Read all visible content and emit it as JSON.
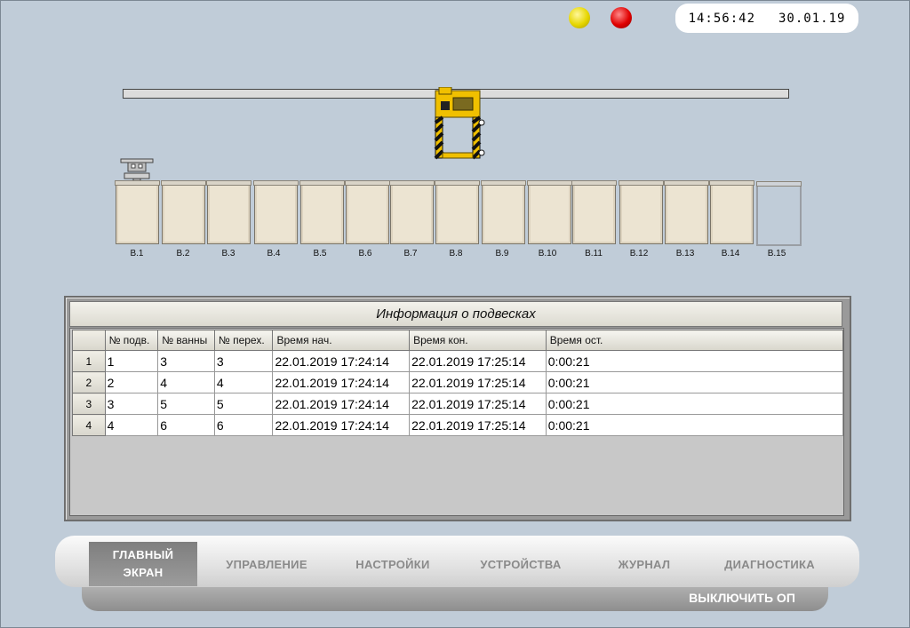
{
  "header": {
    "clock_time": "14:56:42",
    "clock_date": "30.01.19",
    "indicators": [
      {
        "name": "yellow-lamp",
        "color": "#e6d600"
      },
      {
        "name": "red-lamp",
        "color": "#e00000"
      }
    ]
  },
  "line": {
    "baths": [
      {
        "label": "B.1",
        "state": "full"
      },
      {
        "label": "B.2",
        "state": "full"
      },
      {
        "label": "B.3",
        "state": "full"
      },
      {
        "label": "B.4",
        "state": "full"
      },
      {
        "label": "B.5",
        "state": "full"
      },
      {
        "label": "B.6",
        "state": "full"
      },
      {
        "label": "B.7",
        "state": "full"
      },
      {
        "label": "B.8",
        "state": "full"
      },
      {
        "label": "B.9",
        "state": "full"
      },
      {
        "label": "B.10",
        "state": "full"
      },
      {
        "label": "B.11",
        "state": "full"
      },
      {
        "label": "B.12",
        "state": "full"
      },
      {
        "label": "B.13",
        "state": "full"
      },
      {
        "label": "B.14",
        "state": "full"
      },
      {
        "label": "B.15",
        "state": "empty"
      }
    ],
    "crane_color": "#f0c000"
  },
  "info_panel": {
    "title": "Информация о подвесках",
    "columns": [
      "",
      "№ подв.",
      "№ ванны",
      "№ перех.",
      "Время нач.",
      "Время кон.",
      "Время ост."
    ],
    "rows": [
      {
        "num": "1",
        "cells": [
          "1",
          "3",
          "3",
          "22.01.2019 17:24:14",
          "22.01.2019 17:25:14",
          "0:00:21"
        ]
      },
      {
        "num": "2",
        "cells": [
          "2",
          "4",
          "4",
          "22.01.2019 17:24:14",
          "22.01.2019 17:25:14",
          "0:00:21"
        ]
      },
      {
        "num": "3",
        "cells": [
          "3",
          "5",
          "5",
          "22.01.2019 17:24:14",
          "22.01.2019 17:25:14",
          "0:00:21"
        ]
      },
      {
        "num": "4",
        "cells": [
          "4",
          "6",
          "6",
          "22.01.2019 17:24:14",
          "22.01.2019 17:25:14",
          "0:00:21"
        ]
      }
    ]
  },
  "menu": {
    "items": [
      {
        "line1": "ГЛАВНЫЙ",
        "line2": "ЭКРАН",
        "active": true
      },
      {
        "line1": "УПРАВЛЕНИЕ",
        "line2": "",
        "active": false
      },
      {
        "line1": "НАСТРОЙКИ",
        "line2": "",
        "active": false
      },
      {
        "line1": "УСТРОЙСТВА",
        "line2": "",
        "active": false
      },
      {
        "line1": "ЖУРНАЛ",
        "line2": "",
        "active": false
      },
      {
        "line1": "ДИАГНОСТИКА",
        "line2": "",
        "active": false
      }
    ],
    "power_off": "ВЫКЛЮЧИТЬ ОП"
  }
}
